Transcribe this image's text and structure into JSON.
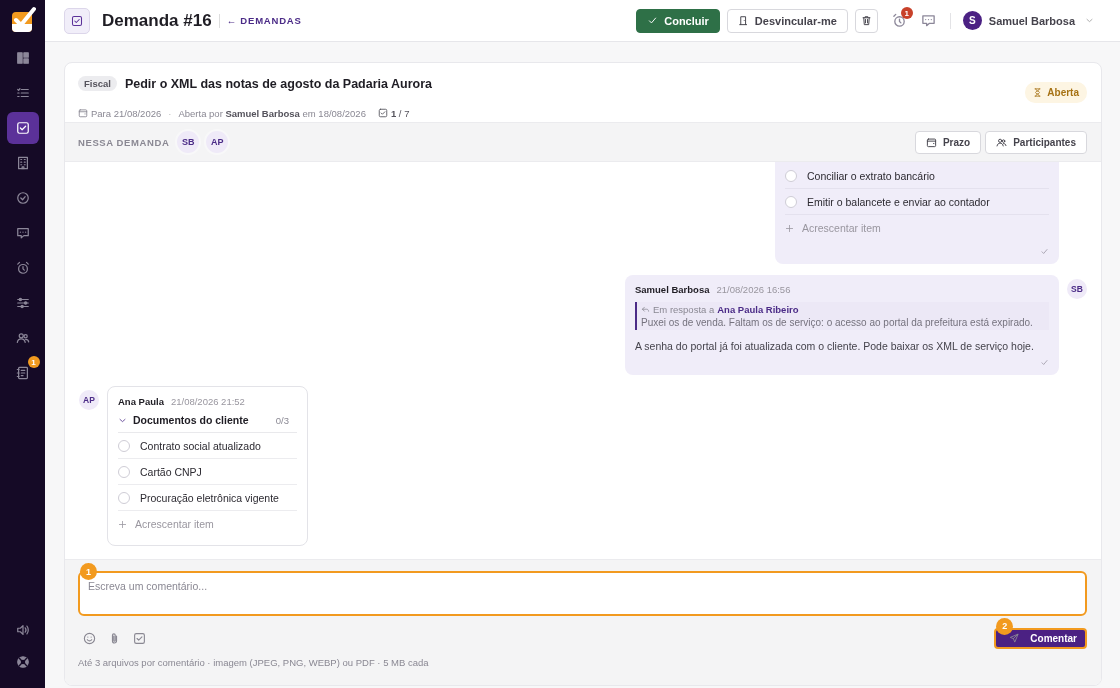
{
  "sidebar": {
    "items": [
      {
        "kind": "dashboard",
        "selected": false
      },
      {
        "kind": "list",
        "selected": false
      },
      {
        "kind": "task",
        "selected": true
      },
      {
        "kind": "building",
        "selected": false
      },
      {
        "kind": "check-circle",
        "selected": false
      },
      {
        "kind": "chat",
        "selected": false
      },
      {
        "kind": "alarm",
        "selected": false
      },
      {
        "kind": "sliders",
        "selected": false
      },
      {
        "kind": "people",
        "selected": false
      },
      {
        "kind": "notebook",
        "selected": false,
        "badge": "1"
      }
    ],
    "bottom_items": [
      {
        "kind": "volume",
        "selected": false
      },
      {
        "kind": "lifebuoy",
        "selected": false
      }
    ]
  },
  "header": {
    "title": "Demanda #16",
    "back_link": "← DEMANDAS",
    "actions": [
      {
        "kind": "primary",
        "label": "Concluir"
      },
      {
        "kind": "secondary",
        "label": "Desvincular-me"
      },
      {
        "kind": "delete"
      }
    ],
    "alarm_badge": "1",
    "user": {
      "initial": "S",
      "name": "Samuel Barbosa"
    }
  },
  "task": {
    "tag": "Fiscal",
    "title": "Pedir o XML das notas de agosto da Padaria Aurora",
    "due": "Para 21/08/2026",
    "separator": "·",
    "opened_by": "Aberta por",
    "author": "Samuel Barbosa",
    "opened_on": "em 18/08/2026",
    "progress_done": "1",
    "progress_sep": "/",
    "progress_total": "7",
    "status": "Aberta"
  },
  "participants": {
    "label": "NESSA DEMANDA",
    "avatars": [
      "SB",
      "AP"
    ],
    "buttons": [
      {
        "kind": "deadline",
        "label": "Prazo"
      },
      {
        "kind": "participants",
        "label": "Participantes"
      }
    ]
  },
  "thread": {
    "messages": [
      {
        "kind": "checklist",
        "mine": true,
        "items": [
          {
            "text": "Conciliar o extrato bancário",
            "checked": false
          },
          {
            "text": "Emitir o balancete e enviar ao contador",
            "checked": false
          }
        ],
        "add_item": "Acrescentar item",
        "seen": true
      },
      {
        "kind": "comment",
        "mine": true,
        "avatar": "SB",
        "author": "Samuel Barbosa",
        "time": "21/08/2026 16:56",
        "reply": {
          "prefix": "Em resposta a",
          "to": "Ana Paula Ribeiro",
          "quote": "Puxei os de venda. Faltam os de serviço: o acesso ao portal da prefeitura está expirado."
        },
        "body": "A senha do portal já foi atualizada com o cliente. Pode baixar os XML de serviço hoje.",
        "seen": true
      },
      {
        "kind": "checklist",
        "mine": false,
        "avatar": "AP",
        "author": "Ana Paula",
        "time": "21/08/2026 21:52",
        "title": "Documentos do cliente",
        "count": "0/3",
        "expanded": true,
        "items": [
          {
            "text": "Contrato social atualizado",
            "checked": false
          },
          {
            "text": "Cartão CNPJ",
            "checked": false
          },
          {
            "text": "Procuração eletrônica vigente",
            "checked": false
          }
        ],
        "add_item": "Acrescentar item",
        "seen": false
      }
    ]
  },
  "composer": {
    "placeholder": "Escreva um comentário...",
    "field_step": "1",
    "button": "Comentar",
    "button_step": "2",
    "hint": "Até 3 arquivos por comentário · imagem (JPEG, PNG, WEBP) ou PDF · 5 MB cada"
  }
}
